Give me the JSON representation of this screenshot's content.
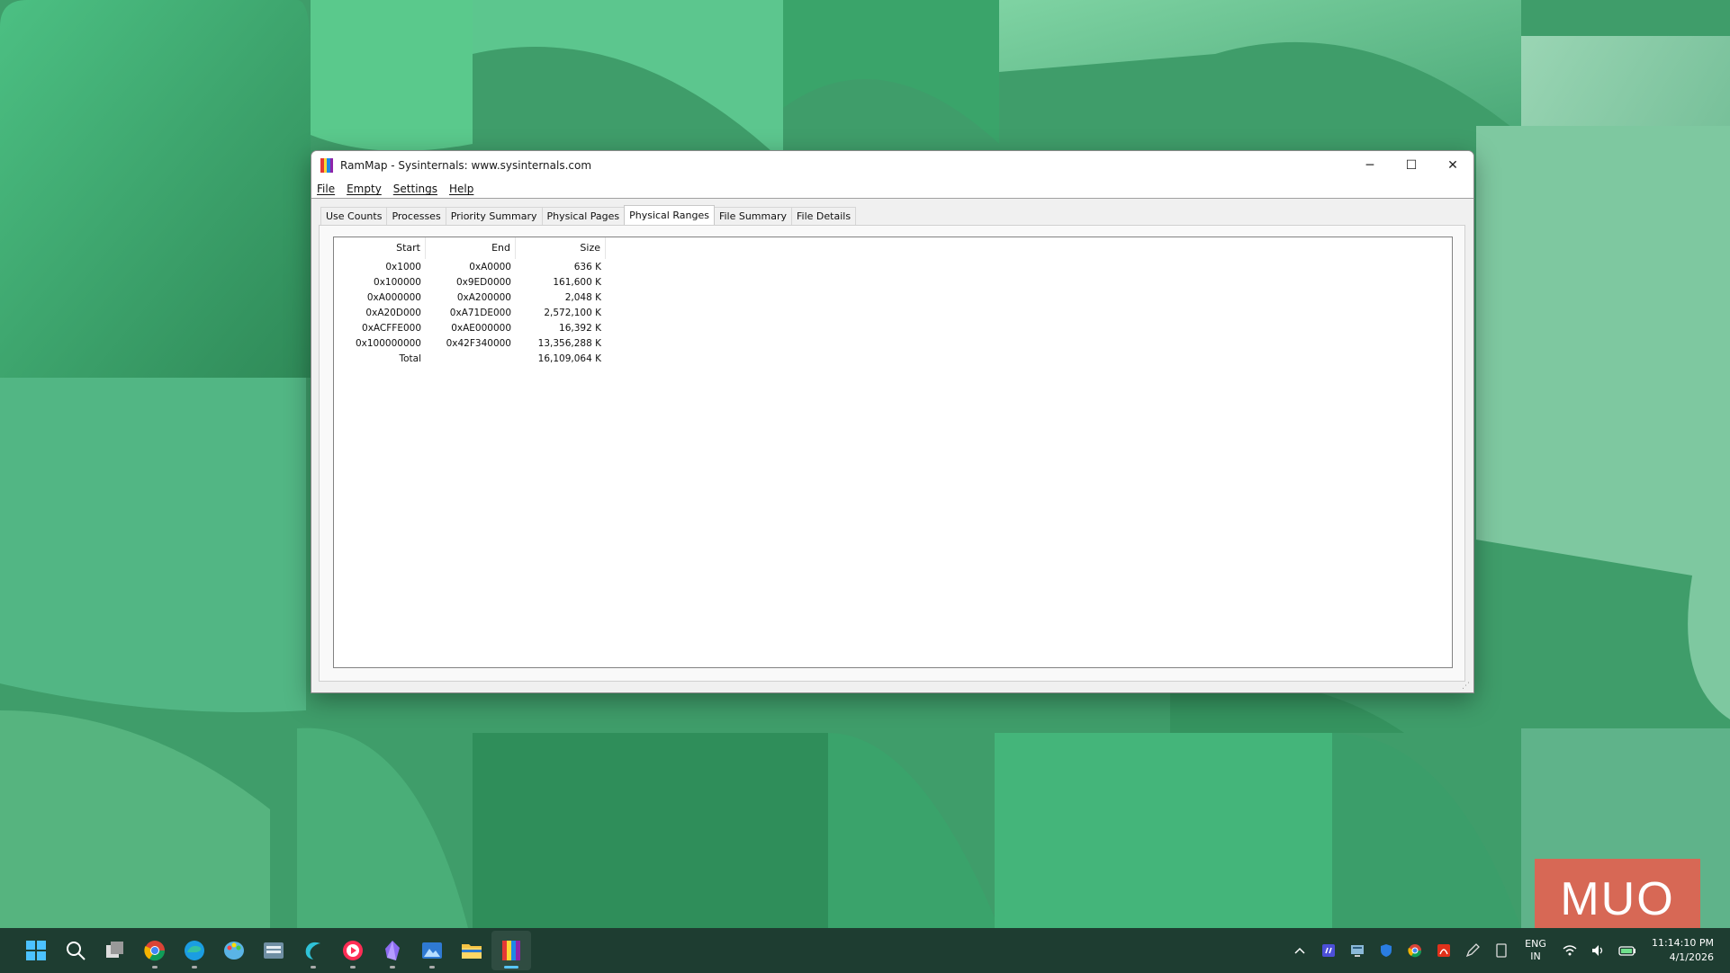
{
  "window": {
    "title": "RamMap - Sysinternals: www.sysinternals.com",
    "menu": [
      "File",
      "Empty",
      "Settings",
      "Help"
    ],
    "tabs": [
      "Use Counts",
      "Processes",
      "Priority Summary",
      "Physical Pages",
      "Physical Ranges",
      "File Summary",
      "File Details"
    ],
    "active_tab": "Physical Ranges",
    "caption": {
      "minimize": "─",
      "maximize": "☐",
      "close": "✕"
    }
  },
  "table": {
    "columns": [
      "Start",
      "End",
      "Size"
    ],
    "rows": [
      [
        "0x1000",
        "0xA0000",
        "636 K"
      ],
      [
        "0x100000",
        "0x9ED0000",
        "161,600 K"
      ],
      [
        "0xA000000",
        "0xA200000",
        "2,048 K"
      ],
      [
        "0xA20D000",
        "0xA71DE000",
        "2,572,100 K"
      ],
      [
        "0xACFFE000",
        "0xAE000000",
        "16,392 K"
      ],
      [
        "0x100000000",
        "0x42F340000",
        "13,356,288 K"
      ],
      [
        "Total",
        "",
        "16,109,064 K"
      ]
    ]
  },
  "watermark": "MUO",
  "taskbar": {
    "apps": [
      "windows-start-icon",
      "search-icon",
      "task-view-icon",
      "chrome-icon",
      "edge-icon",
      "paint-icon",
      "keyboard-app-icon",
      "browser-app-icon",
      "media-player-icon",
      "obsidian-icon",
      "photos-icon",
      "file-explorer-icon",
      "rammap-icon"
    ],
    "active_app": "rammap-icon",
    "tray_icons": [
      "chevron-up-icon",
      "notes-icon",
      "display-icon",
      "defender-icon",
      "chrome-tray-icon",
      "acrobat-icon",
      "pen-icon",
      "tablet-icon"
    ],
    "language_line1": "ENG",
    "language_line2": "IN",
    "time": "11:14:10 PM",
    "date": "4/1/2026"
  },
  "colors": {
    "taskbar": "#1e3d31",
    "accent": "#58c7ff",
    "watermark": "#ec5b4b"
  }
}
